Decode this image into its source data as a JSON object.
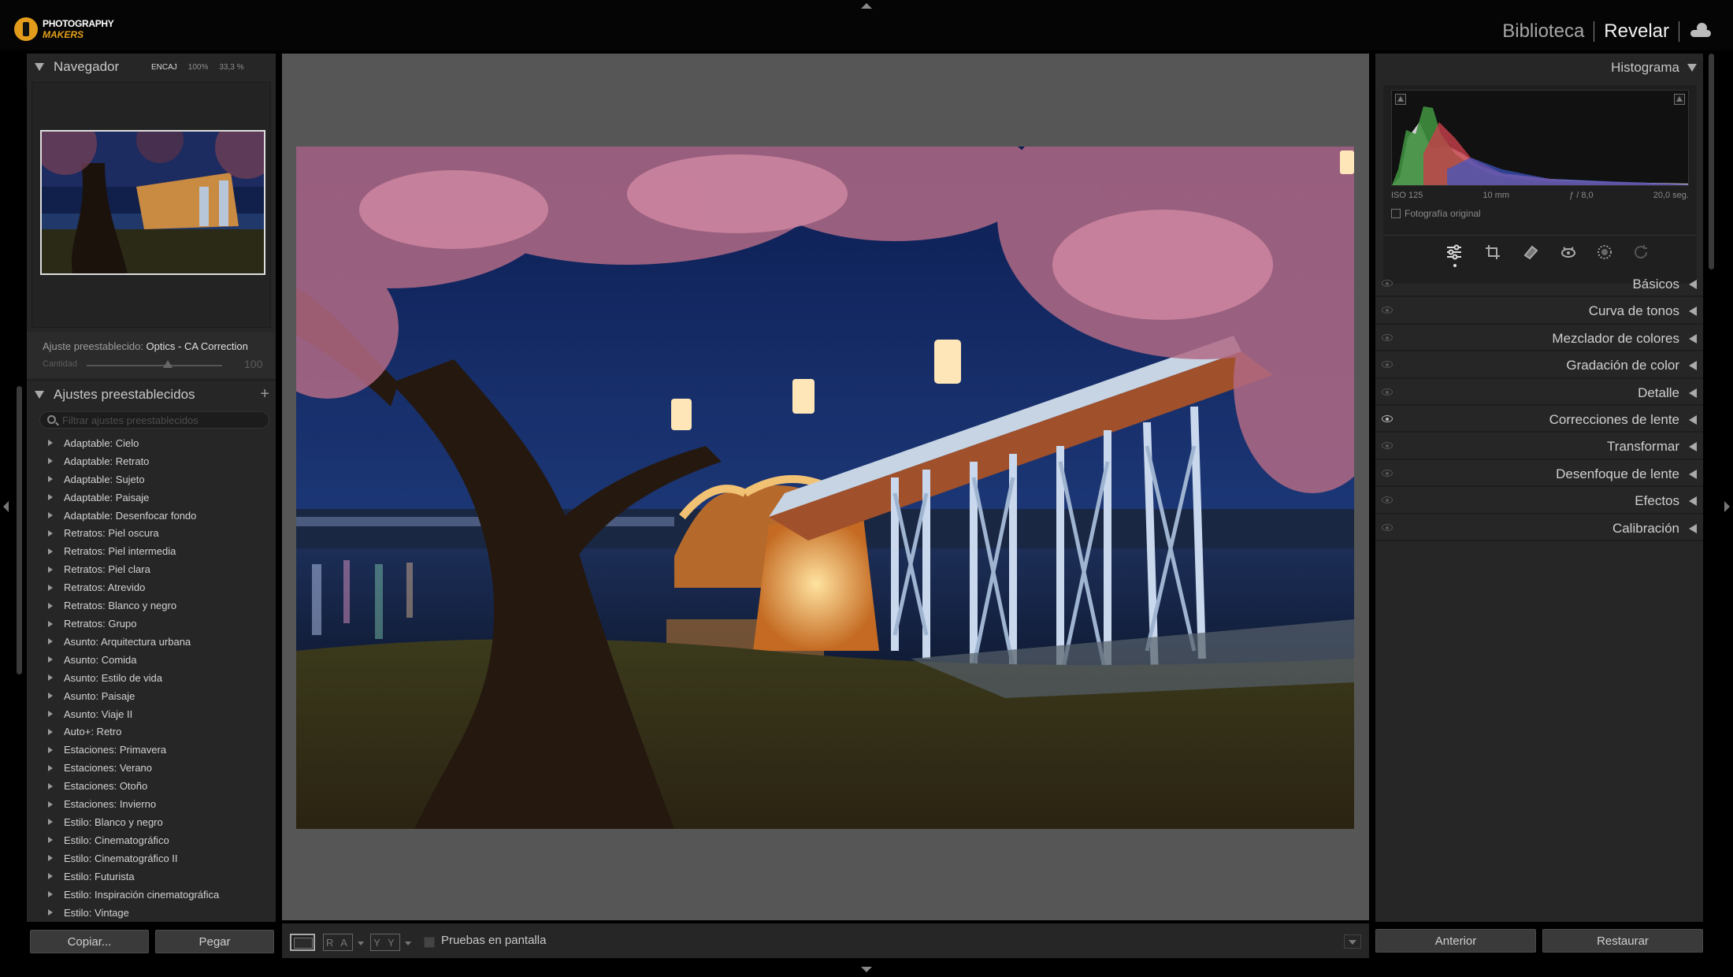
{
  "brand": {
    "line1": "PHOTOGRAPHY",
    "line2": "MAKERS"
  },
  "modules": {
    "library": "Biblioteca",
    "develop": "Revelar"
  },
  "navigator": {
    "title": "Navegador",
    "zoom_options": [
      "ENCAJ",
      "100%",
      "33,3 %"
    ]
  },
  "preset_applied": {
    "label": "Ajuste preestablecido:",
    "name": "Optics - CA Correction",
    "amount_label": "Cantidad",
    "amount_value": "100",
    "amount_level": 0.6
  },
  "presets": {
    "title": "Ajustes preestablecidos",
    "add_label": "+",
    "search_placeholder": "Filtrar ajustes preestablecidos",
    "items": [
      "Adaptable: Cielo",
      "Adaptable: Retrato",
      "Adaptable: Sujeto",
      "Adaptable: Paisaje",
      "Adaptable: Desenfocar fondo",
      "Retratos: Piel oscura",
      "Retratos: Piel intermedia",
      "Retratos: Piel clara",
      "Retratos: Atrevido",
      "Retratos: Blanco y negro",
      "Retratos: Grupo",
      "Asunto: Arquitectura urbana",
      "Asunto: Comida",
      "Asunto: Estilo de vida",
      "Asunto: Paisaje",
      "Asunto: Viaje II",
      "Auto+: Retro",
      "Estaciones: Primavera",
      "Estaciones: Verano",
      "Estaciones: Otoño",
      "Estaciones: Invierno",
      "Estilo: Blanco y negro",
      "Estilo: Cinematográfico",
      "Estilo: Cinematográfico II",
      "Estilo: Futurista",
      "Estilo: Inspiración cinematográfica",
      "Estilo: Vintage"
    ]
  },
  "left_buttons": {
    "copy": "Copiar...",
    "paste": "Pegar"
  },
  "toolbar": {
    "ra": "R A",
    "yy": "Y Y",
    "soft_proof": "Pruebas en pantalla"
  },
  "histogram": {
    "title": "Histograma",
    "iso": "ISO 125",
    "focal": "10 mm",
    "aperture": "ƒ / 8,0",
    "shutter": "20,0 seg.",
    "original_label": "Fotografía original"
  },
  "tools": [
    "sliders-icon",
    "crop-icon",
    "eraser-icon",
    "redeye-icon",
    "mask-icon",
    "history-icon"
  ],
  "panels": [
    {
      "label": "Básicos",
      "eye_on": false
    },
    {
      "label": "Curva de tonos",
      "eye_on": false
    },
    {
      "label": "Mezclador de colores",
      "eye_on": false
    },
    {
      "label": "Gradación de color",
      "eye_on": false
    },
    {
      "label": "Detalle",
      "eye_on": false
    },
    {
      "label": "Correcciones de lente",
      "eye_on": true
    },
    {
      "label": "Transformar",
      "eye_on": false
    },
    {
      "label": "Desenfoque de lente",
      "eye_on": false
    },
    {
      "label": "Efectos",
      "eye_on": false
    },
    {
      "label": "Calibración",
      "eye_on": false
    }
  ],
  "right_buttons": {
    "previous": "Anterior",
    "reset": "Restaurar"
  },
  "colors": {
    "accent": "#e6a11c",
    "panel": "#262626",
    "canvas": "#565656"
  }
}
